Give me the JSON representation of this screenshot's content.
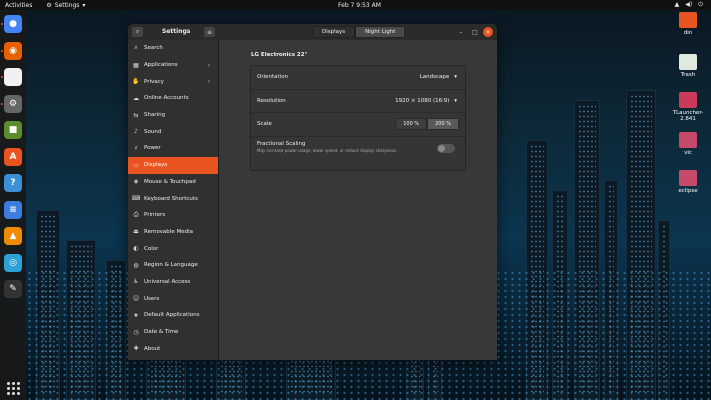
{
  "topbar": {
    "activities": "Activities",
    "app_name": "Settings",
    "clock": "Feb 7  9:53 AM",
    "tray": [
      "▲",
      "◀)",
      "⏻"
    ]
  },
  "dock": {
    "apps": [
      {
        "name": "chrome-icon",
        "color": "#4285f4",
        "glyph": "●"
      },
      {
        "name": "firefox-icon",
        "color": "#e66000",
        "glyph": "◉"
      },
      {
        "name": "files-icon",
        "color": "#f1f1f1",
        "glyph": ""
      },
      {
        "name": "settings-icon",
        "color": "#666",
        "glyph": "⚙"
      },
      {
        "name": "minecraft-icon",
        "color": "#5b8c2a",
        "glyph": "■"
      },
      {
        "name": "software-icon",
        "color": "#e95420",
        "glyph": "A"
      },
      {
        "name": "help-icon",
        "color": "#3a8fd6",
        "glyph": "?"
      },
      {
        "name": "text-editor-icon",
        "color": "#3b7ee0",
        "glyph": "≡"
      },
      {
        "name": "vlc-icon",
        "color": "#f08a00",
        "glyph": "▲"
      },
      {
        "name": "gedit-icon",
        "color": "#2ea0d8",
        "glyph": "◎"
      },
      {
        "name": "inkscape-icon",
        "color": "#333",
        "glyph": "✎"
      }
    ]
  },
  "desktop": {
    "icons": [
      {
        "label": "din",
        "color": "#e95420"
      },
      {
        "label": "Trash",
        "color": "#dfe9df"
      },
      {
        "label": "TLauncher-2.841",
        "color": "#cc3a5a"
      },
      {
        "label": "vlc",
        "color": "#c84a6a"
      },
      {
        "label": "eclipse",
        "color": "#c84a6a"
      }
    ]
  },
  "window": {
    "title": "Settings",
    "tabs": [
      "Displays",
      "Night Light"
    ],
    "controls": {
      "minimize": "–",
      "maximize": "□",
      "close": "×"
    },
    "sidebar": [
      {
        "label": "Search",
        "icon": "⌕"
      },
      {
        "label": "Applications",
        "icon": "▦",
        "chevron": true
      },
      {
        "label": "Privacy",
        "icon": "✋",
        "chevron": true
      },
      {
        "label": "Online Accounts",
        "icon": "☁"
      },
      {
        "label": "Sharing",
        "icon": "⇆"
      },
      {
        "label": "Sound",
        "icon": "♪"
      },
      {
        "label": "Power",
        "icon": "⚡"
      },
      {
        "label": "Displays",
        "icon": "▭",
        "selected": true
      },
      {
        "label": "Mouse & Touchpad",
        "icon": "◈"
      },
      {
        "label": "Keyboard Shortcuts",
        "icon": "⌨"
      },
      {
        "label": "Printers",
        "icon": "⎙"
      },
      {
        "label": "Removable Media",
        "icon": "⏏"
      },
      {
        "label": "Color",
        "icon": "◐"
      },
      {
        "label": "Region & Language",
        "icon": "◍"
      },
      {
        "label": "Universal Access",
        "icon": "♿"
      },
      {
        "label": "Users",
        "icon": "☺"
      },
      {
        "label": "Default Applications",
        "icon": "★"
      },
      {
        "label": "Date & Time",
        "icon": "◷"
      },
      {
        "label": "About",
        "icon": "✚"
      }
    ],
    "monitor_name": "LG Electronics 22\"",
    "rows": {
      "orientation": {
        "label": "Orientation",
        "value": "Landscape"
      },
      "resolution": {
        "label": "Resolution",
        "value": "1920 × 1080 (16∶9)"
      },
      "scale": {
        "label": "Scale",
        "options": [
          "100 %",
          "200 %"
        ],
        "selected": "200 %"
      },
      "fractional": {
        "label": "Fractional Scaling",
        "description": "May increase power usage, lower speed, or reduce display sharpness.",
        "enabled": false
      }
    }
  }
}
